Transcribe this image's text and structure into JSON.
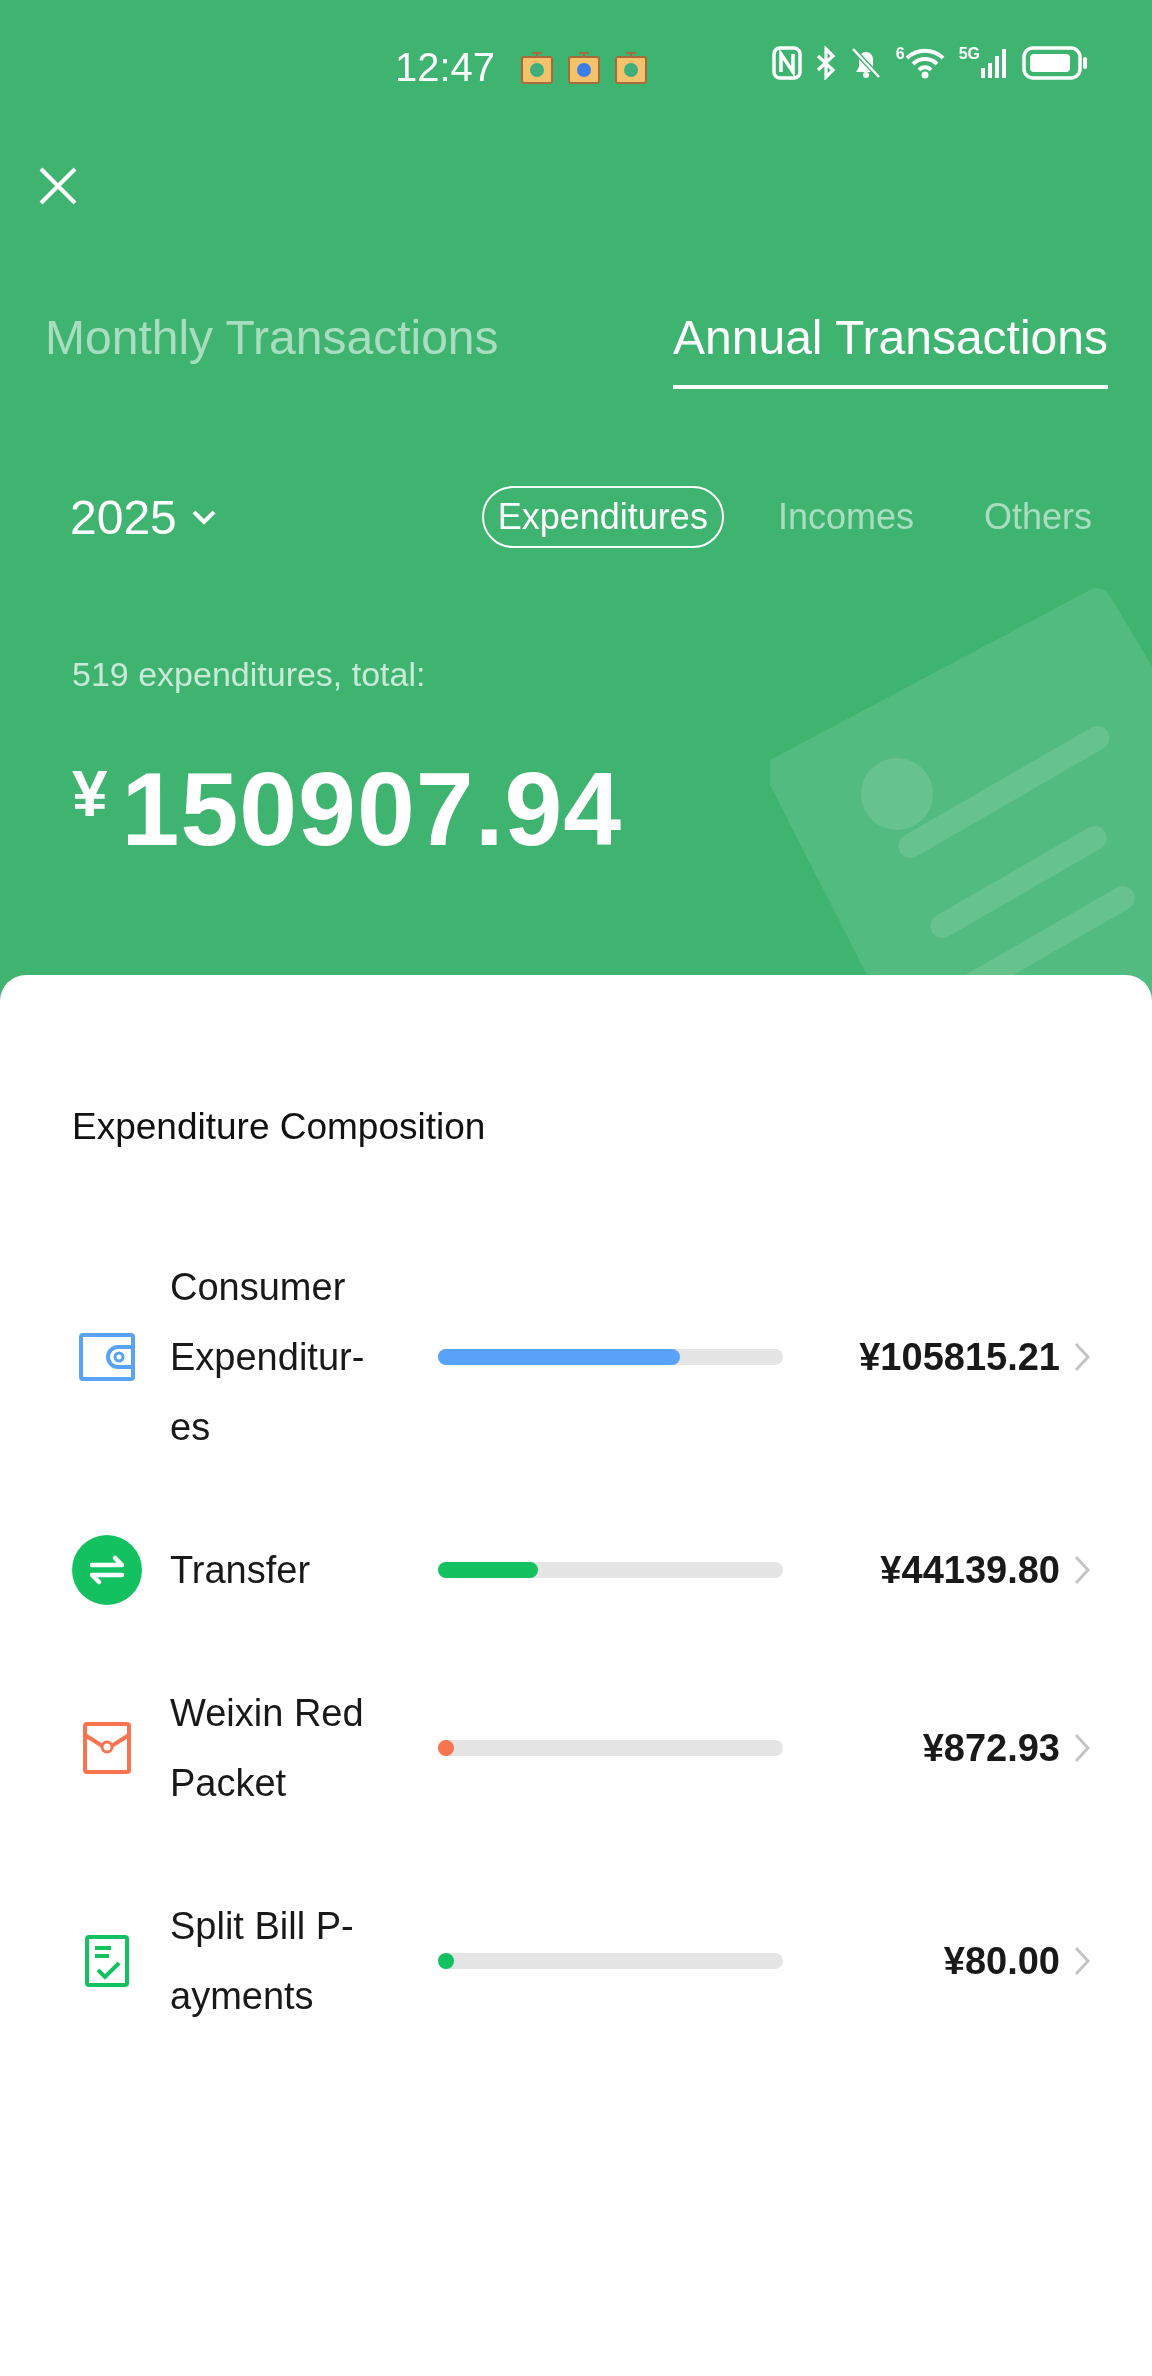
{
  "status_bar": {
    "time": "12:47",
    "wifi_badge": "6",
    "network": "5G"
  },
  "tabs": [
    {
      "label": "Monthly Transactions",
      "selected": false
    },
    {
      "label": "Annual Transactions",
      "selected": true
    }
  ],
  "year": "2025",
  "filters": [
    {
      "label": "Expenditures",
      "selected": true
    },
    {
      "label": "Incomes",
      "selected": false
    },
    {
      "label": "Others",
      "selected": false
    }
  ],
  "summary": {
    "caption": "519 expenditures, total:",
    "currency": "¥",
    "total": "150907.94"
  },
  "composition": {
    "title": "Expenditure Composition",
    "categories": [
      {
        "kind": "wallet",
        "label_lines": [
          "Consumer",
          "Expenditur-",
          "es"
        ],
        "level": 0.7,
        "color": "#58a2f7",
        "amount": "¥105815.21"
      },
      {
        "kind": "transfer",
        "label_lines": [
          "Transfer"
        ],
        "level": 0.29,
        "color": "#13c161",
        "amount": "¥44139.80"
      },
      {
        "kind": "red_packet",
        "label_lines": [
          "Weixin Red",
          "Packet"
        ],
        "level": 0.006,
        "color": "#f7744f",
        "amount": "¥872.93"
      },
      {
        "kind": "split_bill",
        "label_lines": [
          "Split Bill P-",
          "ayments"
        ],
        "level": 0.0005,
        "color": "#13c161",
        "amount": "¥80.00"
      }
    ]
  }
}
